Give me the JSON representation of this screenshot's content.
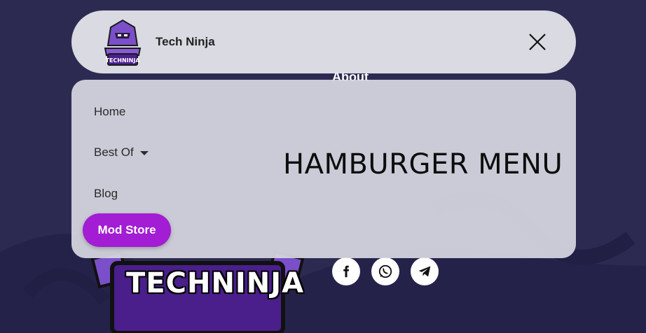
{
  "header": {
    "brand": "Tech Ninja",
    "logo_icon": "ninja-logo-icon",
    "logo_text": "TECHNINJA",
    "close_icon": "close-icon"
  },
  "menu": {
    "items": [
      {
        "label": "Home"
      },
      {
        "label": "Best Of",
        "icon": "caret-down-icon"
      },
      {
        "label": "Blog"
      }
    ],
    "cta_label": "Mod Store",
    "cta_color": "#a21dd3"
  },
  "overlay_title": "HAMBURGER MENU",
  "background": {
    "about_heading": "About",
    "logo_text": "TECHNINJA",
    "social_icons": [
      "facebook-icon",
      "whatsapp-icon",
      "telegram-icon"
    ],
    "color": "#2d2a52"
  }
}
